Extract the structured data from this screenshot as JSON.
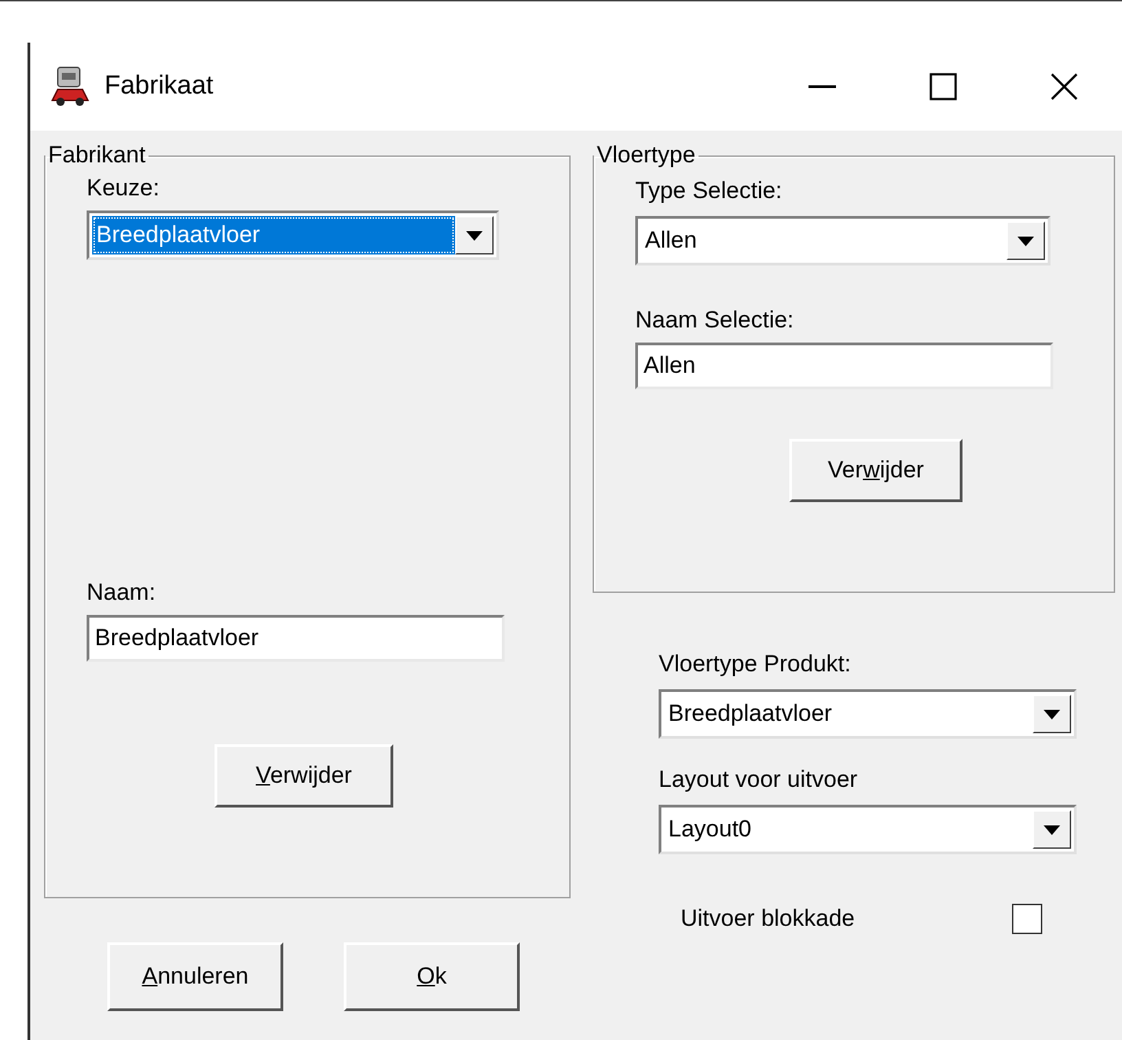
{
  "window": {
    "title": "Fabrikaat"
  },
  "fabrikant": {
    "legend": "Fabrikant",
    "keuze_label": "Keuze:",
    "keuze": {
      "value": "Breedplaatvloer",
      "focused": true
    },
    "naam_label": "Naam:",
    "naam": {
      "value": "Breedplaatvloer"
    },
    "delete_button": {
      "access_key": "V",
      "label_end": "erwijder"
    }
  },
  "vloertype": {
    "legend": "Vloertype",
    "type_label": "Type Selectie:",
    "type": {
      "value": "Allen",
      "focused": false
    },
    "naam_label": "Naam Selectie:",
    "naam": {
      "value": "Allen"
    },
    "delete_button": {
      "label_start": "Ver",
      "access_key": "w",
      "label_end": "ijder"
    }
  },
  "produkt": {
    "label": "Vloertype Produkt:",
    "value": "Breedplaatvloer",
    "focused": false
  },
  "layout": {
    "label": "Layout voor uitvoer",
    "value": "Layout0",
    "focused": false
  },
  "buttons": [
    {
      "access_key": "A",
      "label_end": "nnuleren"
    },
    {
      "access_key": "O",
      "label_end": "k"
    }
  ],
  "blokkade": {
    "label": "Uitvoer blokkade",
    "checked": false
  }
}
